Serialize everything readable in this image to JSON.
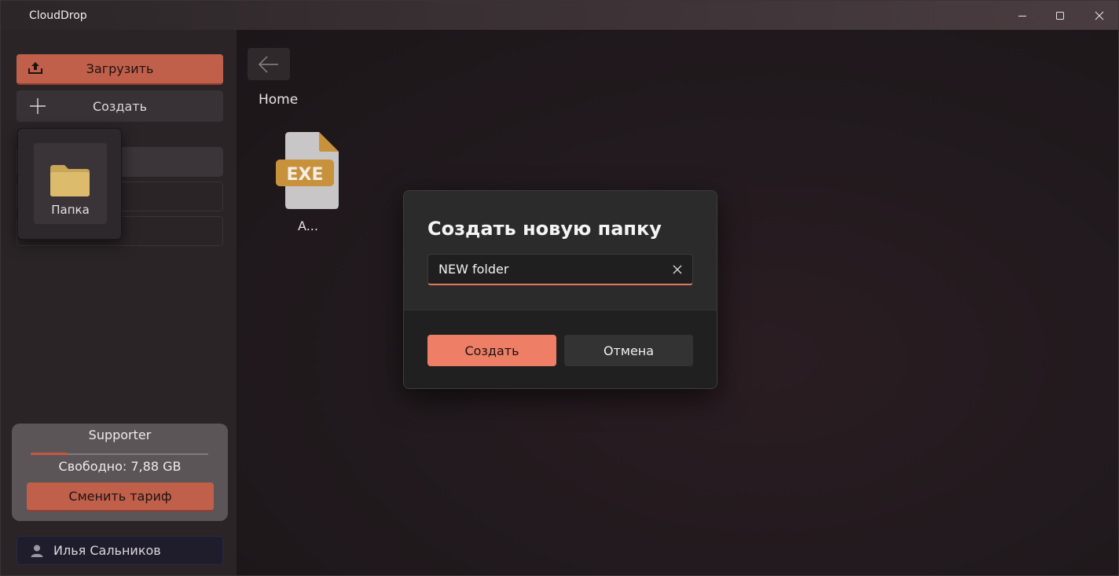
{
  "window": {
    "title": "CloudDrop"
  },
  "sidebar": {
    "upload_label": "Загрузить",
    "create_label": "Создать",
    "create_flyout": {
      "folder_label": "Папка"
    },
    "plan": {
      "name": "Supporter",
      "used_fraction": 0.21,
      "free_label": "Свободно: 7,88 GB",
      "change_plan_label": "Сменить тариф"
    },
    "user": {
      "name": "Илья Сальников"
    }
  },
  "main": {
    "breadcrumb": "Home",
    "files": [
      {
        "name": "A...",
        "type_badge": "EXE"
      }
    ]
  },
  "dialog": {
    "title": "Создать новую папку",
    "input_value": "NEW folder",
    "primary_label": "Создать",
    "secondary_label": "Отмена"
  },
  "colors": {
    "accent": "#c0604a",
    "dialog_primary": "#ee7f66",
    "exe_badge": "#c8923c",
    "folder": "#d8b66a"
  }
}
